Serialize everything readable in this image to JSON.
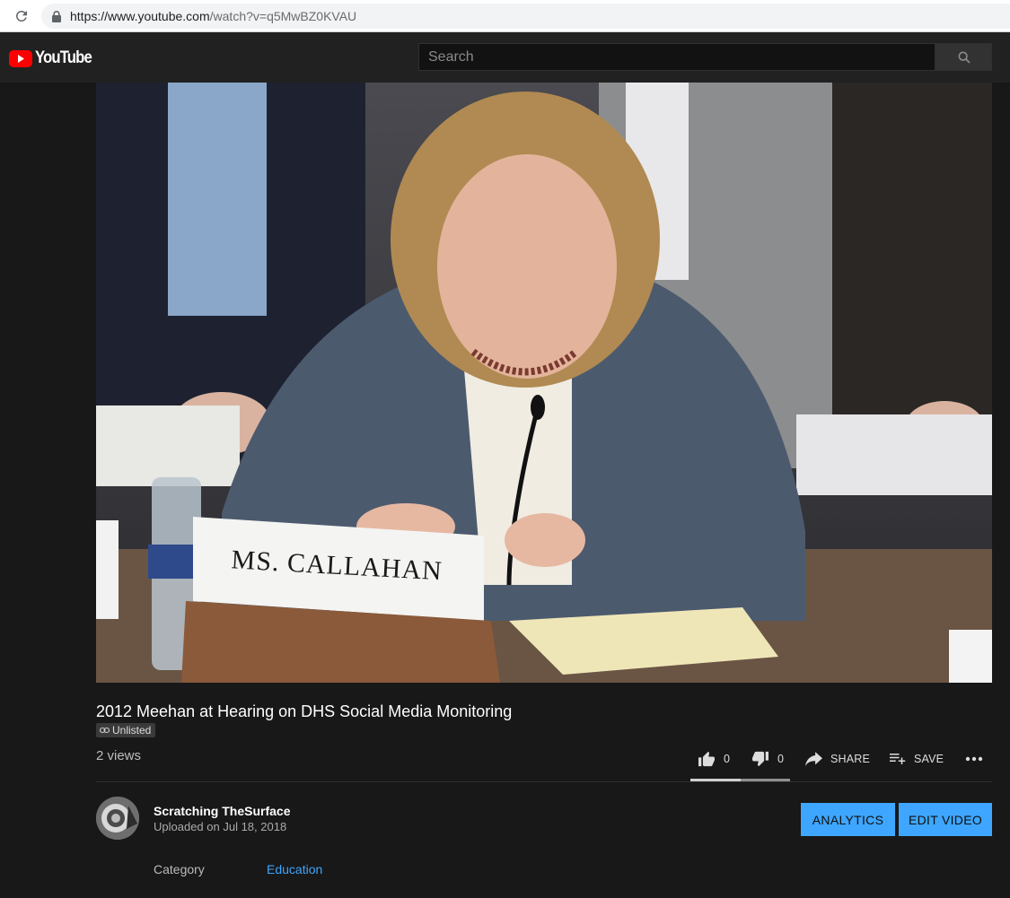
{
  "browser": {
    "url_host": "https://www.youtube.com",
    "url_path": "/watch?v=q5MwBZ0KVAU"
  },
  "masthead": {
    "logo_text": "YouTube",
    "search_placeholder": "Search"
  },
  "video": {
    "nameplate": "MS. CALLAHAN"
  },
  "info": {
    "title": "2012 Meehan at Hearing on DHS Social Media Monitoring",
    "badge": "Unlisted",
    "views": "2 views",
    "likes": "0",
    "dislikes": "0",
    "share_label": "SHARE",
    "save_label": "SAVE"
  },
  "channel": {
    "name": "Scratching TheSurface",
    "uploaded": "Uploaded on Jul 18, 2018",
    "analytics_label": "ANALYTICS",
    "edit_label": "EDIT VIDEO"
  },
  "meta": {
    "category_label": "Category",
    "category_value": "Education"
  },
  "colors": {
    "accent": "#3ea6ff",
    "youtube_red": "#ff0000",
    "background": "#181818",
    "masthead": "#212121"
  },
  "icons": {
    "reload": "reload-icon",
    "lock": "lock-icon",
    "search": "search-icon",
    "like": "thumbs-up-icon",
    "dislike": "thumbs-down-icon",
    "share": "share-icon",
    "save": "playlist-add-icon",
    "more": "more-icon",
    "link": "link-icon"
  }
}
